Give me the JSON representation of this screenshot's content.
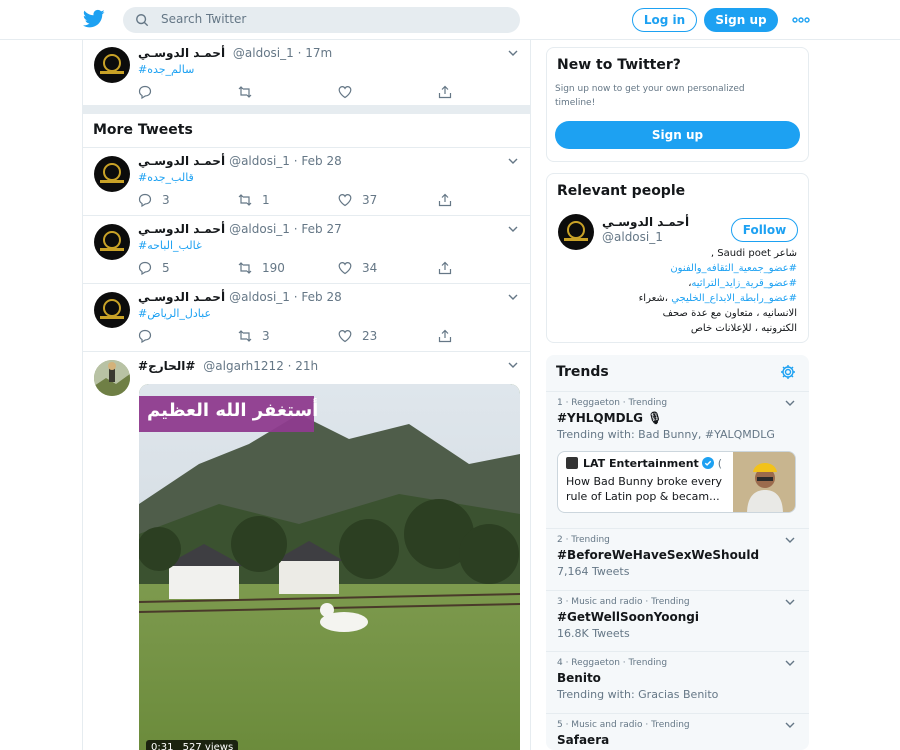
{
  "header": {
    "search_placeholder": "Search Twitter",
    "login_label": "Log in",
    "signup_label": "Sign up",
    "brand_color": "#1da1f2"
  },
  "top_tweet": {
    "name": "أحمـد الدوسـي",
    "handle": "@aldosi_1 · 17m",
    "text": "#سالم_جده"
  },
  "more_tweets_title": "More Tweets",
  "tweets": [
    {
      "name": "أحمـد الدوسـي",
      "handle": "@aldosi_1 · Feb 28",
      "text": "#قالب_جده",
      "replies": "3",
      "retweets": "1",
      "likes": "37"
    },
    {
      "name": "أحمـد الدوسـي",
      "handle": "@aldosi_1 · Feb 27",
      "text": "#غالب_الباحه",
      "replies": "5",
      "retweets": "190",
      "likes": "34"
    },
    {
      "name": "أحمـد الدوسـي",
      "handle": "@aldosi_1 · Feb 28",
      "text": "#عبادل_الرياض",
      "replies": "",
      "retweets": "3",
      "likes": "23"
    }
  ],
  "video_tweet": {
    "name": "#الحارج#",
    "handle": "@algarh1212 · 21h",
    "overlay_text": "أستغفر الله العظيم",
    "duration": "0:31",
    "views": "527 views"
  },
  "new_to_twitter": {
    "title": "New to Twitter?",
    "subtitle": "Sign up now to get your own personalized timeline!",
    "button": "Sign up"
  },
  "relevant_people": {
    "title": "Relevant people",
    "name": "أحمـد الدوسـي",
    "handle": "@aldosi_1",
    "follow": "Follow",
    "bio_line1": "شاعر Saudi poet ,",
    "bio_line2": "#عضو_جمعية_الثقافه_والفنون",
    "bio_line3": "#عضو_قرية_زايد_التراثيه",
    "bio_line3_suffix": "،",
    "bio_line4_link": "#عضو_رابطة_الابداع_الخليجي",
    "bio_line4_text": " ،شعراء",
    "bio_line5": "الانسانيه ، متعاون مع عدة صحف",
    "bio_line6": "الكترونيه ، للإعلانات خاص"
  },
  "trends": {
    "title": "Trends",
    "items": [
      {
        "meta": "1 · Reggaeton · Trending",
        "name": "#YHLQMDLG 🎙",
        "sub": "Trending with: Bad Bunny, #YALQMDLG"
      },
      {
        "meta": "2 · Trending",
        "name": "#BeforeWeHaveSexWeShould",
        "sub": "7,164 Tweets"
      },
      {
        "meta": "3 · Music and radio · Trending",
        "name": "#GetWellSoonYoongi",
        "sub": "16.8K Tweets"
      },
      {
        "meta": "4 · Reggaeton · Trending",
        "name": "Benito",
        "sub": "Trending with: Gracias Benito"
      },
      {
        "meta": "5 · Music and radio · Trending",
        "name": "Safaera",
        "sub": ""
      }
    ],
    "news": {
      "source": "LAT Entertainment",
      "source_suffix": "(",
      "headline": "How Bad Bunny broke every rule of Latin pop & becam..."
    }
  }
}
